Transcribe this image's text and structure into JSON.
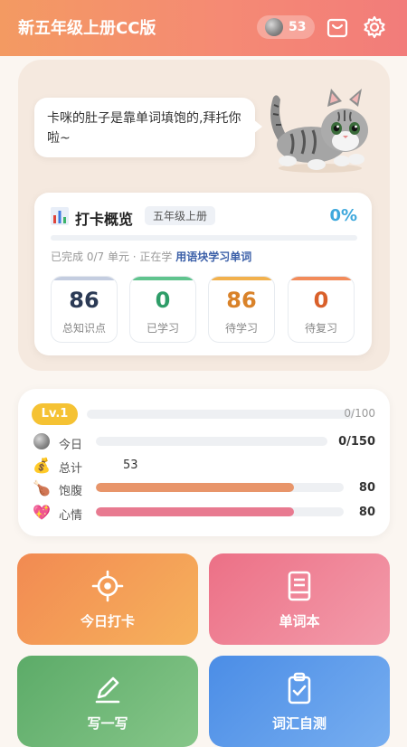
{
  "header": {
    "title": "新五年级上册CC版",
    "coin_count": "53",
    "cart_icon": "shopping-bag-icon",
    "settings_icon": "gear-icon"
  },
  "mascot": {
    "speech": "卡咪的肚子是靠单词填饱的,拜托你啦~",
    "image": "kitten-illustration"
  },
  "checkin": {
    "title": "打卡概览",
    "grade_tag": "五年级上册",
    "percent_label": "0%",
    "percent": 0,
    "progress_text": "已完成 0/7 单元 · 正在学",
    "current_unit": "用语块学习单词",
    "stats": [
      {
        "value": "86",
        "label": "总知识点",
        "color": "#2b3a55",
        "bar": "#c4cde0"
      },
      {
        "value": "0",
        "label": "已学习",
        "color": "#2e9d68",
        "bar": "#60c48e"
      },
      {
        "value": "86",
        "label": "待学习",
        "color": "#d98229",
        "bar": "#f2b14d"
      },
      {
        "value": "0",
        "label": "待复习",
        "color": "#d9602a",
        "bar": "#f28b5a"
      }
    ]
  },
  "level": {
    "badge": "Lv.1",
    "xp_text": "0/100",
    "xp_fraction": 0.0,
    "today_label": "今日",
    "today_value": "0/150",
    "today_fraction": 0.0,
    "total_label": "总计",
    "total_value": "53",
    "hunger_label": "饱腹",
    "hunger_value": "80",
    "hunger_fraction": 0.8,
    "mood_label": "心情",
    "mood_value": "80",
    "mood_fraction": 0.8,
    "colors": {
      "hunger": "#e8956a",
      "mood": "#e87a90"
    }
  },
  "tiles": [
    {
      "label": "今日打卡",
      "icon": "crosshair-target-icon"
    },
    {
      "label": "单词本",
      "icon": "book-icon"
    },
    {
      "label": "写一写",
      "icon": "pencil-icon"
    },
    {
      "label": "词汇自测",
      "icon": "clipboard-check-icon"
    }
  ]
}
